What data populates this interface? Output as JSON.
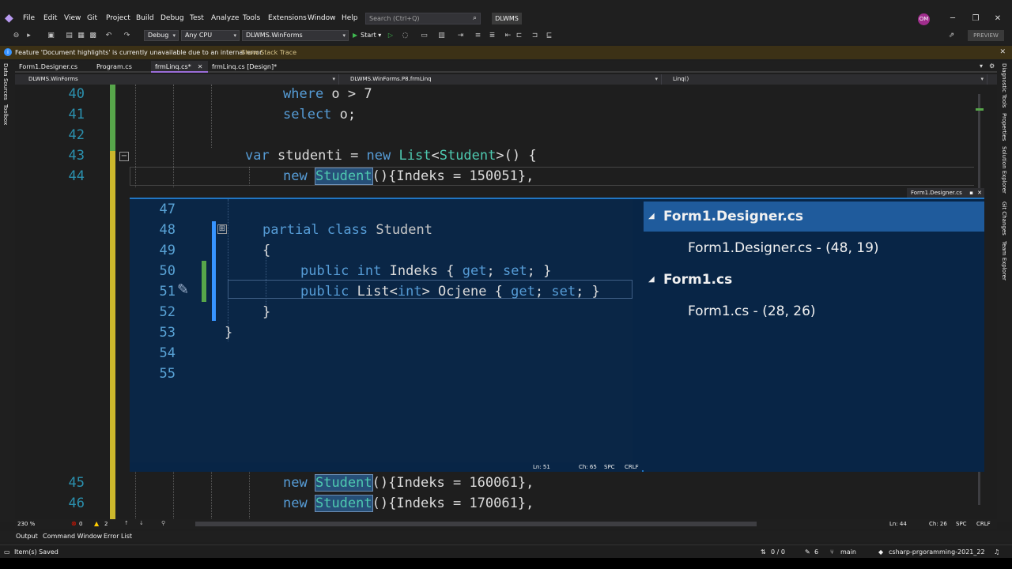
{
  "menu": {
    "items": [
      "File",
      "Edit",
      "View",
      "Git",
      "Project",
      "Build",
      "Debug",
      "Test",
      "Analyze",
      "Tools",
      "Extensions",
      "Window",
      "Help"
    ],
    "search_placeholder": "Search (Ctrl+Q)",
    "solution_name": "DLWMS",
    "avatar_initials": "OM"
  },
  "toolbar": {
    "configuration": "Debug",
    "platform": "Any CPU",
    "startup_project": "DLWMS.WinForms",
    "start_label": "Start",
    "preview_label": "PREVIEW"
  },
  "infobar": {
    "message": "Feature 'Document highlights' is currently unavailable due to an internal error.",
    "link": "Show Stack Trace"
  },
  "left_dock": [
    "Data Sources",
    "Toolbox"
  ],
  "right_dock": [
    "Diagnostic Tools",
    "Properties",
    "Solution Explorer",
    "Git Changes",
    "Team Explorer"
  ],
  "doc_tabs": [
    {
      "label": "Form1.Designer.cs"
    },
    {
      "label": "Program.cs"
    },
    {
      "label": "frmLinq.cs*"
    },
    {
      "label": "frmLinq.cs [Design]*"
    }
  ],
  "navbar": {
    "project": "DLWMS.WinForms",
    "type": "DLWMS.WinForms.P8.frmLinq",
    "member": "Linq()"
  },
  "editor": {
    "lines": [
      {
        "n": "40",
        "text": "where o > 7"
      },
      {
        "n": "41",
        "text": "select o;"
      },
      {
        "n": "42",
        "text": ""
      },
      {
        "n": "43",
        "text": "var studenti = new List<Student>() {"
      },
      {
        "n": "44",
        "text": "new Student(){Indeks = 150051},"
      },
      {
        "n": "45",
        "text": "new Student(){Indeks = 160061},"
      },
      {
        "n": "46",
        "text": "new Student(){Indeks = 170061},"
      }
    ],
    "zoom": "230 %",
    "errors": "0",
    "warnings": "2",
    "ln": "Ln: 44",
    "ch": "Ch: 26",
    "spc": "SPC",
    "crlf": "CRLF"
  },
  "peek": {
    "title": "Form1.Designer.cs",
    "lines": [
      {
        "n": "47"
      },
      {
        "n": "48"
      },
      {
        "n": "49"
      },
      {
        "n": "50"
      },
      {
        "n": "51"
      },
      {
        "n": "52"
      },
      {
        "n": "53"
      },
      {
        "n": "54"
      },
      {
        "n": "55"
      }
    ],
    "groups": [
      {
        "file": "Form1.Designer.cs",
        "entry": "Form1.Designer.cs - (48, 19)"
      },
      {
        "file": "Form1.cs",
        "entry": "Form1.cs - (28, 26)"
      }
    ],
    "ln": "Ln: 51",
    "ch": "Ch: 65",
    "spc": "SPC",
    "crlf": "CRLF"
  },
  "tool_tabs": [
    "Output",
    "Command Window",
    "Error List"
  ],
  "status": {
    "message": "Item(s) Saved",
    "updown": "0 / 0",
    "pencil": "6",
    "branch": "main",
    "repo": "csharp-prgoramming-2021_22"
  },
  "colors": {
    "keyword": "#569cd6",
    "type": "#4ec9b0",
    "peek_bg": "#082546",
    "accent": "#9a6dd7"
  }
}
